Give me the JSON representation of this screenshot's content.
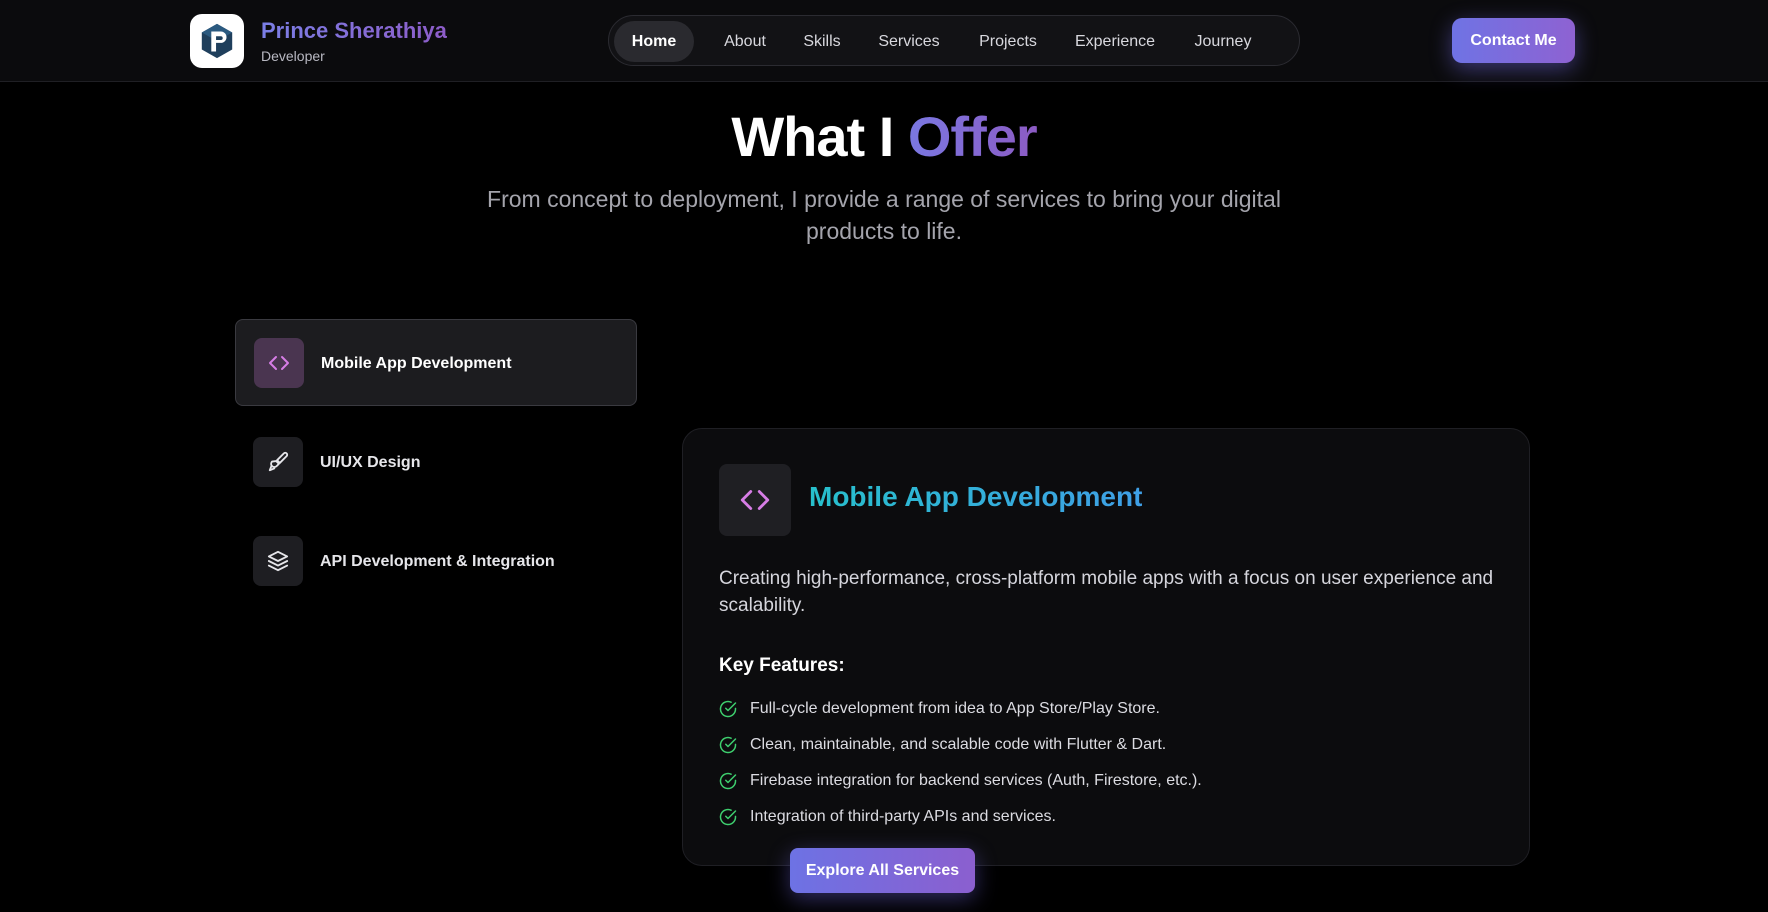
{
  "header": {
    "brand_name": "Prince Sherathiya",
    "brand_role": "Developer",
    "logo_icon": "p-logo-icon",
    "nav": [
      {
        "label": "Home",
        "active": true
      },
      {
        "label": "About",
        "active": false
      },
      {
        "label": "Skills",
        "active": false
      },
      {
        "label": "Services",
        "active": false
      },
      {
        "label": "Projects",
        "active": false
      },
      {
        "label": "Experience",
        "active": false
      },
      {
        "label": "Journey",
        "active": false
      }
    ],
    "contact_label": "Contact Me"
  },
  "section": {
    "title_prefix": "What I",
    "title_accent": "Offer",
    "subtitle": "From concept to deployment, I provide a range of services to bring your digital products to life."
  },
  "services": [
    {
      "label": "Mobile App Development",
      "icon": "code-icon",
      "active": true
    },
    {
      "label": "UI/UX Design",
      "icon": "paintbrush-icon",
      "active": false
    },
    {
      "label": "API Development & Integration",
      "icon": "layers-icon",
      "active": false
    }
  ],
  "detail": {
    "icon": "code-icon",
    "title": "Mobile App Development",
    "description": "Creating high-performance, cross-platform mobile apps with a focus on user experience and scalability.",
    "features_heading": "Key Features:",
    "features": [
      "Full-cycle development from idea to App Store/Play Store.",
      "Clean, maintainable, and scalable code with Flutter & Dart.",
      "Firebase integration for backend services (Auth, Firestore, etc.).",
      "Integration of third-party APIs and services."
    ]
  },
  "explore_label": "Explore All Services",
  "colors": {
    "accent_purple": "#8b5fcf",
    "accent_blue": "#6f73e4",
    "title_cyan": "#27c0cc",
    "check_green": "#3ecf6e",
    "code_icon_pink": "#d77de6"
  }
}
